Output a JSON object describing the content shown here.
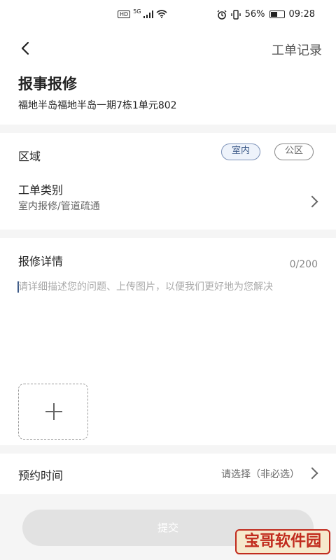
{
  "status_bar": {
    "network_left": "HD",
    "network_sup": "5G",
    "battery_percent": "56%",
    "battery_level": 0.56,
    "time": "09:28",
    "icons": [
      "alarm-icon",
      "vibrate-icon",
      "signal-icon",
      "wifi-icon",
      "battery-icon"
    ]
  },
  "nav": {
    "back_icon": "chevron-left-icon",
    "right_link": "工单记录"
  },
  "header": {
    "title": "报事报修",
    "address": "福地半岛福地半岛一期7栋1单元802"
  },
  "area": {
    "label": "区域",
    "options": [
      "室内",
      "公区"
    ],
    "selected": "室内"
  },
  "category": {
    "label": "工单类别",
    "value": "室内报修/管道疏通"
  },
  "details": {
    "label": "报修详情",
    "counter": "0/200",
    "placeholder": "请详细描述您的问题、上传图片，以便我们更好地为您解决"
  },
  "appointment": {
    "label": "预约时间",
    "value": "请选择（非必选）"
  },
  "submit_label": "提交",
  "watermark": "宝哥软件园",
  "colors": {
    "accent": "#3d5a88",
    "accent_bg": "#eef3fb",
    "page_bg": "#f5f5f5",
    "submit_bg": "#e2e2e2",
    "watermark_red": "#c12b1e"
  }
}
